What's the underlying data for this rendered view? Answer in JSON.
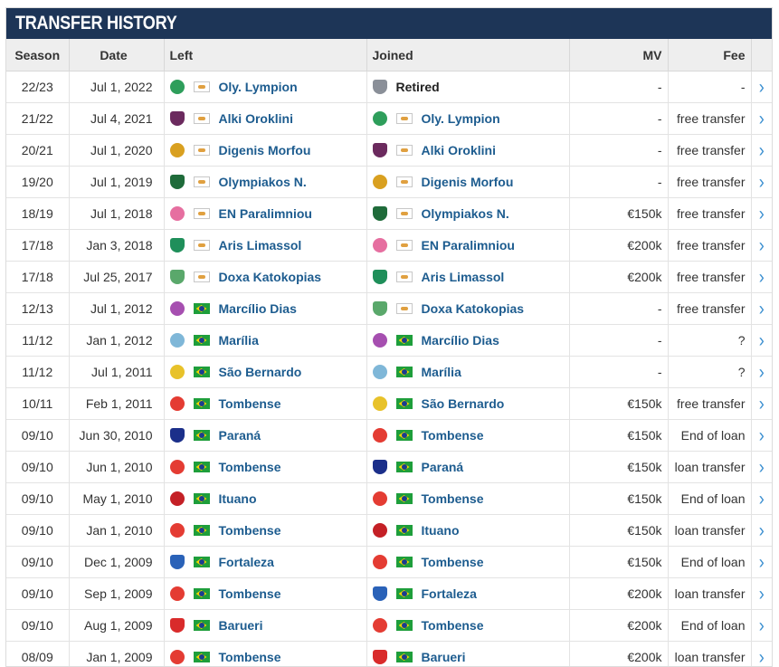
{
  "header": {
    "title": "TRANSFER HISTORY"
  },
  "columns": {
    "season": "Season",
    "date": "Date",
    "left": "Left",
    "joined": "Joined",
    "mv": "MV",
    "fee": "Fee"
  },
  "colors": {
    "header_bg": "#1d3557",
    "link": "#1d5c8f",
    "arrow": "#3b8fd0",
    "crest_olympion": "#2e9e5b",
    "crest_alki": "#6b2a5e",
    "crest_digenis": "#d9a020",
    "crest_olympiakos": "#1f6b3a",
    "crest_paralimniou": "#e66fa0",
    "crest_aris": "#1f8f5a",
    "crest_doxa": "#5aa86b",
    "crest_marcilio": "#a64fb0",
    "crest_marilia": "#7fb7d8",
    "crest_saobernardo": "#e8c22a",
    "crest_tombense": "#e43c33",
    "crest_parana": "#1b2f8a",
    "crest_ituano": "#c42026",
    "crest_fortaleza": "#2a62b8",
    "crest_barueri": "#d92b2b",
    "crest_retired": "#8a8f98"
  },
  "rows": [
    {
      "season": "22/23",
      "date": "Jul 1, 2022",
      "left": {
        "name": "Oly. Lympion",
        "crest": "crest_olympion",
        "flag": "cy",
        "icon": "cyprus-flag-icon"
      },
      "joined": {
        "name": "Retired",
        "crest": "crest_retired",
        "flag": "",
        "icon": "retired-icon"
      },
      "mv": "-",
      "fee": "-"
    },
    {
      "season": "21/22",
      "date": "Jul 4, 2021",
      "left": {
        "name": "Alki Oroklini",
        "crest": "crest_alki",
        "flag": "cy",
        "icon": "cyprus-flag-icon"
      },
      "joined": {
        "name": "Oly. Lympion",
        "crest": "crest_olympion",
        "flag": "cy",
        "icon": "cyprus-flag-icon"
      },
      "mv": "-",
      "fee": "free transfer"
    },
    {
      "season": "20/21",
      "date": "Jul 1, 2020",
      "left": {
        "name": "Digenis Morfou",
        "crest": "crest_digenis",
        "flag": "cy",
        "icon": "cyprus-flag-icon"
      },
      "joined": {
        "name": "Alki Oroklini",
        "crest": "crest_alki",
        "flag": "cy",
        "icon": "cyprus-flag-icon"
      },
      "mv": "-",
      "fee": "free transfer"
    },
    {
      "season": "19/20",
      "date": "Jul 1, 2019",
      "left": {
        "name": "Olympiakos N.",
        "crest": "crest_olympiakos",
        "flag": "cy",
        "icon": "cyprus-flag-icon"
      },
      "joined": {
        "name": "Digenis Morfou",
        "crest": "crest_digenis",
        "flag": "cy",
        "icon": "cyprus-flag-icon"
      },
      "mv": "-",
      "fee": "free transfer"
    },
    {
      "season": "18/19",
      "date": "Jul 1, 2018",
      "left": {
        "name": "EN Paralimniou",
        "crest": "crest_paralimniou",
        "flag": "cy",
        "icon": "cyprus-flag-icon"
      },
      "joined": {
        "name": "Olympiakos N.",
        "crest": "crest_olympiakos",
        "flag": "cy",
        "icon": "cyprus-flag-icon"
      },
      "mv": "€150k",
      "fee": "free transfer"
    },
    {
      "season": "17/18",
      "date": "Jan 3, 2018",
      "left": {
        "name": "Aris Limassol",
        "crest": "crest_aris",
        "flag": "cy",
        "icon": "cyprus-flag-icon"
      },
      "joined": {
        "name": "EN Paralimniou",
        "crest": "crest_paralimniou",
        "flag": "cy",
        "icon": "cyprus-flag-icon"
      },
      "mv": "€200k",
      "fee": "free transfer"
    },
    {
      "season": "17/18",
      "date": "Jul 25, 2017",
      "left": {
        "name": "Doxa Katokopias",
        "crest": "crest_doxa",
        "flag": "cy",
        "icon": "cyprus-flag-icon"
      },
      "joined": {
        "name": "Aris Limassol",
        "crest": "crest_aris",
        "flag": "cy",
        "icon": "cyprus-flag-icon"
      },
      "mv": "€200k",
      "fee": "free transfer"
    },
    {
      "season": "12/13",
      "date": "Jul 1, 2012",
      "left": {
        "name": "Marcílio Dias",
        "crest": "crest_marcilio",
        "flag": "br",
        "icon": "brazil-flag-icon"
      },
      "joined": {
        "name": "Doxa Katokopias",
        "crest": "crest_doxa",
        "flag": "cy",
        "icon": "cyprus-flag-icon"
      },
      "mv": "-",
      "fee": "free transfer"
    },
    {
      "season": "11/12",
      "date": "Jan 1, 2012",
      "left": {
        "name": "Marília",
        "crest": "crest_marilia",
        "flag": "br",
        "icon": "brazil-flag-icon"
      },
      "joined": {
        "name": "Marcílio Dias",
        "crest": "crest_marcilio",
        "flag": "br",
        "icon": "brazil-flag-icon"
      },
      "mv": "-",
      "fee": "?"
    },
    {
      "season": "11/12",
      "date": "Jul 1, 2011",
      "left": {
        "name": "São Bernardo",
        "crest": "crest_saobernardo",
        "flag": "br",
        "icon": "brazil-flag-icon"
      },
      "joined": {
        "name": "Marília",
        "crest": "crest_marilia",
        "flag": "br",
        "icon": "brazil-flag-icon"
      },
      "mv": "-",
      "fee": "?"
    },
    {
      "season": "10/11",
      "date": "Feb 1, 2011",
      "left": {
        "name": "Tombense",
        "crest": "crest_tombense",
        "flag": "br",
        "icon": "brazil-flag-icon"
      },
      "joined": {
        "name": "São Bernardo",
        "crest": "crest_saobernardo",
        "flag": "br",
        "icon": "brazil-flag-icon"
      },
      "mv": "€150k",
      "fee": "free transfer"
    },
    {
      "season": "09/10",
      "date": "Jun 30, 2010",
      "left": {
        "name": "Paraná",
        "crest": "crest_parana",
        "flag": "br",
        "icon": "brazil-flag-icon"
      },
      "joined": {
        "name": "Tombense",
        "crest": "crest_tombense",
        "flag": "br",
        "icon": "brazil-flag-icon"
      },
      "mv": "€150k",
      "fee": "End of loan"
    },
    {
      "season": "09/10",
      "date": "Jun 1, 2010",
      "left": {
        "name": "Tombense",
        "crest": "crest_tombense",
        "flag": "br",
        "icon": "brazil-flag-icon"
      },
      "joined": {
        "name": "Paraná",
        "crest": "crest_parana",
        "flag": "br",
        "icon": "brazil-flag-icon"
      },
      "mv": "€150k",
      "fee": "loan transfer"
    },
    {
      "season": "09/10",
      "date": "May 1, 2010",
      "left": {
        "name": "Ituano",
        "crest": "crest_ituano",
        "flag": "br",
        "icon": "brazil-flag-icon"
      },
      "joined": {
        "name": "Tombense",
        "crest": "crest_tombense",
        "flag": "br",
        "icon": "brazil-flag-icon"
      },
      "mv": "€150k",
      "fee": "End of loan"
    },
    {
      "season": "09/10",
      "date": "Jan 1, 2010",
      "left": {
        "name": "Tombense",
        "crest": "crest_tombense",
        "flag": "br",
        "icon": "brazil-flag-icon"
      },
      "joined": {
        "name": "Ituano",
        "crest": "crest_ituano",
        "flag": "br",
        "icon": "brazil-flag-icon"
      },
      "mv": "€150k",
      "fee": "loan transfer"
    },
    {
      "season": "09/10",
      "date": "Dec 1, 2009",
      "left": {
        "name": "Fortaleza",
        "crest": "crest_fortaleza",
        "flag": "br",
        "icon": "brazil-flag-icon"
      },
      "joined": {
        "name": "Tombense",
        "crest": "crest_tombense",
        "flag": "br",
        "icon": "brazil-flag-icon"
      },
      "mv": "€150k",
      "fee": "End of loan"
    },
    {
      "season": "09/10",
      "date": "Sep 1, 2009",
      "left": {
        "name": "Tombense",
        "crest": "crest_tombense",
        "flag": "br",
        "icon": "brazil-flag-icon"
      },
      "joined": {
        "name": "Fortaleza",
        "crest": "crest_fortaleza",
        "flag": "br",
        "icon": "brazil-flag-icon"
      },
      "mv": "€200k",
      "fee": "loan transfer"
    },
    {
      "season": "09/10",
      "date": "Aug 1, 2009",
      "left": {
        "name": "Barueri",
        "crest": "crest_barueri",
        "flag": "br",
        "icon": "brazil-flag-icon"
      },
      "joined": {
        "name": "Tombense",
        "crest": "crest_tombense",
        "flag": "br",
        "icon": "brazil-flag-icon"
      },
      "mv": "€200k",
      "fee": "End of loan"
    },
    {
      "season": "08/09",
      "date": "Jan 1, 2009",
      "left": {
        "name": "Tombense",
        "crest": "crest_tombense",
        "flag": "br",
        "icon": "brazil-flag-icon"
      },
      "joined": {
        "name": "Barueri",
        "crest": "crest_barueri",
        "flag": "br",
        "icon": "brazil-flag-icon"
      },
      "mv": "€200k",
      "fee": "loan transfer"
    }
  ],
  "row_action_icon": "chevron-right-icon",
  "row_action_glyph": "›"
}
